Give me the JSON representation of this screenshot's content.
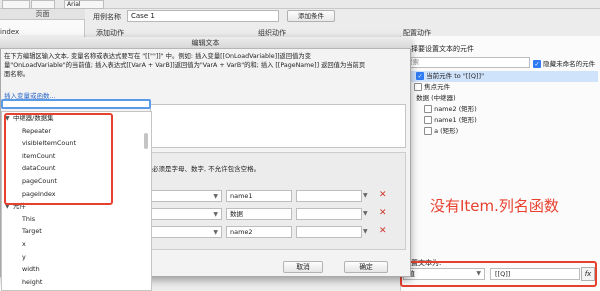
{
  "toolbar": {
    "font": "Arial"
  },
  "left_panel": {
    "header": "页面",
    "index_label": "index"
  },
  "case": {
    "name_label": "用例名称",
    "name_value": "Case 1",
    "add_condition": "添加条件"
  },
  "columns": {
    "add_action": "添加动作",
    "org_action": "组织动作",
    "config_action": "配置动作"
  },
  "modal": {
    "title": "编辑文本",
    "description_lines": [
      "在下方编辑区输入文本, 变量名称或表达式要写在 \"[[\"\"]]\" 中。例如: 插入变量[[OnLoadVariable]]返回值为变",
      "量\"OnLoadVariable\"的当前值; 插入表达式[[VarA + VarB]]返回值为\"VarA + VarB\"的和; 插入 [[PageName]] 返回值为当前页",
      "面名称。"
    ],
    "insert_link": "插入变量或函数...",
    "local_var_note": "必须是字母、数字, 不允许包含空格。",
    "variables": [
      {
        "name": "name1",
        "object": ""
      },
      {
        "name": "数据",
        "object": ""
      },
      {
        "name": "name2",
        "object": ""
      }
    ],
    "cancel": "取消",
    "ok": "确定"
  },
  "function_list": {
    "items": [
      {
        "label": "中继器/数据集",
        "type": "group",
        "expanded": true
      },
      {
        "label": "Repeater",
        "type": "item"
      },
      {
        "label": "visibleItemCount",
        "type": "item"
      },
      {
        "label": "itemCount",
        "type": "item"
      },
      {
        "label": "dataCount",
        "type": "item"
      },
      {
        "label": "pageCount",
        "type": "item"
      },
      {
        "label": "pageIndex",
        "type": "item"
      },
      {
        "label": "元件",
        "type": "group",
        "expanded": true
      },
      {
        "label": "This",
        "type": "item"
      },
      {
        "label": "Target",
        "type": "item"
      },
      {
        "label": "x",
        "type": "item"
      },
      {
        "label": "y",
        "type": "item"
      },
      {
        "label": "width",
        "type": "item"
      },
      {
        "label": "height",
        "type": "item"
      }
    ]
  },
  "config": {
    "select_title": "选择要设置文本的元件",
    "search_placeholder": "搜索",
    "hide_unnamed": "隐藏未命名的元件",
    "tree": [
      {
        "label": "当前元件 to \"[[Q]]\"",
        "checked": true,
        "selected": true,
        "indent": 1
      },
      {
        "label": "焦点元件",
        "checked": false,
        "selected": false,
        "indent": 1
      },
      {
        "label": "数据 (中继器)",
        "checked": false,
        "selected": false,
        "indent": 0,
        "group": true
      },
      {
        "label": "name2 (矩形)",
        "checked": false,
        "selected": false,
        "indent": 2
      },
      {
        "label": "name1 (矩形)",
        "checked": false,
        "selected": false,
        "indent": 2
      },
      {
        "label": "a (矩形)",
        "checked": false,
        "selected": false,
        "indent": 2
      }
    ],
    "set_text_label": "设置文本为:",
    "set_text_type": "值",
    "set_text_value": "[[Q]]",
    "fx": "fx"
  },
  "annotation": "没有Item.列名函数",
  "colors": {
    "highlight": "#e8402f",
    "selection": "#cfe3fb",
    "accent": "#2f7bf5"
  }
}
